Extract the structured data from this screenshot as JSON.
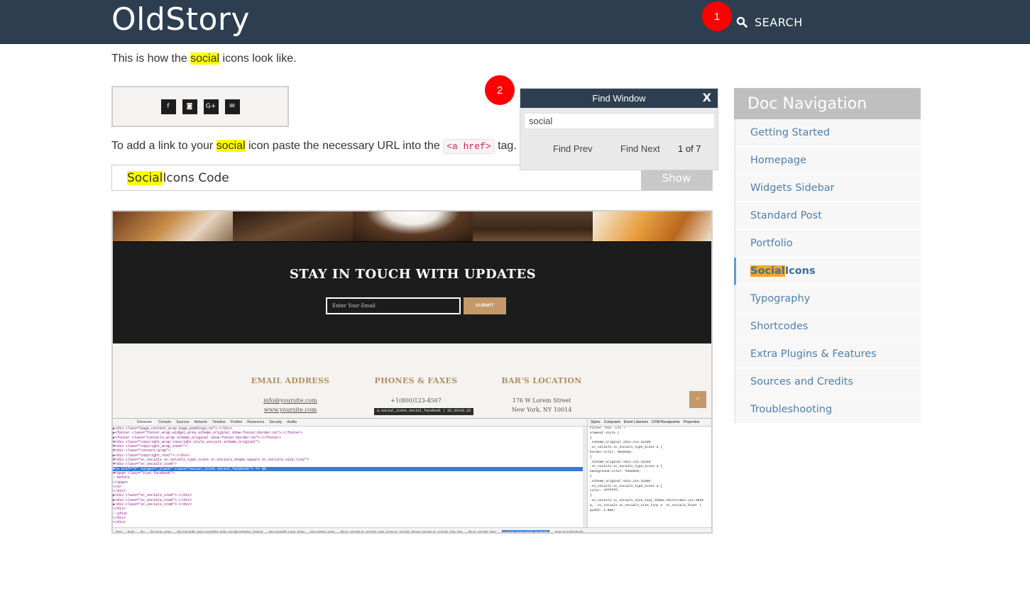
{
  "header": {
    "site_title": "OldStory",
    "search_label": "Search"
  },
  "markers": {
    "one": "1",
    "two": "2"
  },
  "content": {
    "intro": {
      "before": "This is how the ",
      "highlight": "social",
      "after": " icons look like."
    },
    "social_squares": [
      "f",
      "◙",
      "G+",
      "✉"
    ],
    "link_para": {
      "before": "To add a link to your ",
      "highlight": "social",
      "mid": " icon paste the necessary URL into the ",
      "code": "<a href>",
      "after": " tag."
    },
    "code_bar": {
      "highlight": "Social",
      "rest": " Icons Code",
      "show_button": "Show"
    }
  },
  "screenshot": {
    "newsletter_title": "STAY IN TOUCH WITH UPDATES",
    "email_placeholder": "Enter Your Email",
    "submit_label": "SUBMIT",
    "columns": [
      {
        "heading": "EMAIL ADDRESS",
        "lines": [
          "info@yoursite.com",
          "www.yoursite.com"
        ]
      },
      {
        "heading": "PHONES & FAXES",
        "lines": [
          "+1(800)123-4567",
          ""
        ]
      },
      {
        "heading": "BAR'S LOCATION",
        "lines": [
          "176 W Lorem Street",
          "New York, NY 10014"
        ]
      }
    ],
    "up_button": "^",
    "tooltip": "a.social_icons.social_facebook | 33.33×33.33",
    "devtools_tabs": [
      "Elements",
      "Console",
      "Sources",
      "Network",
      "Timeline",
      "Profiles",
      "Resources",
      "Security",
      "Audits"
    ],
    "devtools_lines": [
      "▶<div class=\"page_content_wrap page_paddings_no\">…</div>",
      "▶<footer class=\"footer_wrap widget_area scheme_original show-footer-border-no\">…</footer>",
      "▶<footer class=\"contacts_wrap scheme_original show-footer-border-no\">…</footer>",
      "▼<div class=\"copyright_wrap copyright_style_socials scheme_original\">",
      "  ▼<div class=\"copyright_wrap_inner\">",
      "    ▼<div class=\"content_wrap\">",
      "      ▶<div class=\"copyright_text\">…</div>",
      "      ▼<div class=\"sc_socials sc_socials_type_icons sc_socials_shape_square sc_socials_size_tiny\">",
      "        ▼<div class=\"sc_socials_item\">",
      "          ▼<a href=\"#\" target=\"_blank\" class=\"social_icons social_facebook\"> == $0",
      "            ▼<span class=\"icon-facebook\">",
      "               ::before",
      "             </span>",
      "           </a>",
      "         </div>",
      "        ▶<div class=\"sc_socials_item\">…</div>",
      "        ▶<div class=\"sc_socials_item\">…</div>",
      "        ▶<div class=\"sc_socials_item\">…</div>",
      "       </div>",
      "       ::after",
      "     </div>",
      "   </div>"
    ],
    "styles_tabs": [
      "Styles",
      "Computed",
      "Event Listeners",
      "DOM Breakpoints",
      "Properties"
    ],
    "styles_lines": [
      "Filter                               :hov  .cls  +",
      "element.style {",
      "}",
      ".scheme_original               skin.css:12426",
      ".sc_socials.sc_socials_type_icons a {",
      "  border-color: #6e6e6e;",
      "}",
      ".scheme_original               skin.css:12416",
      ".sc_socials.sc_socials_type_icons a {",
      "  background-color: #252525;",
      "}",
      ".scheme_original               skin.css:12404",
      ".sc_socials.sc_socials_type_icons a {",
      "  color: #ffffff;",
      "}",
      ".sc_socials.sc_socials_size_tiny  theme.shortcodes.css:3943",
      "a, .sc_socials.sc_socials_size_tiny a .sc_socials_hover {",
      "  width: 2.0em;"
    ],
    "crumbs": [
      "html",
      "body",
      "div",
      "div.page_wrap",
      "div.copyright_wrap.copyright_style_socials.scheme_original",
      "div.copyright_wrap_inner",
      "div.content_wrap",
      "div.sc_socials.sc_socials_type_icons.sc_socials_shape_square.sc_socials_size_tiny",
      "div.sc_socials_item",
      "a.social_icons.social_facebook",
      "span.icon-facebook"
    ]
  },
  "find_window": {
    "title": "Find Window",
    "close": "X",
    "query": "social",
    "prev": "Find Prev",
    "next": "Find Next",
    "count": "1 of 7"
  },
  "doc_nav": {
    "heading": "Doc Navigation",
    "items": [
      {
        "label": "Getting Started"
      },
      {
        "label": "Homepage"
      },
      {
        "label": "Widgets Sidebar"
      },
      {
        "label": "Standard Post"
      },
      {
        "label": "Portfolio"
      },
      {
        "label": "Social Icons",
        "highlight": "Social",
        "rest": " Icons"
      },
      {
        "label": "Typography"
      },
      {
        "label": "Shortcodes"
      },
      {
        "label": "Extra Plugins & Features"
      },
      {
        "label": "Sources and Credits"
      },
      {
        "label": "Troubleshooting"
      }
    ]
  },
  "colors": {
    "header_bg": "#2d3e50",
    "highlight": "#ffff00",
    "active_highlight": "#f5a623",
    "marker": "#ff0000",
    "link": "#4f7faf"
  }
}
